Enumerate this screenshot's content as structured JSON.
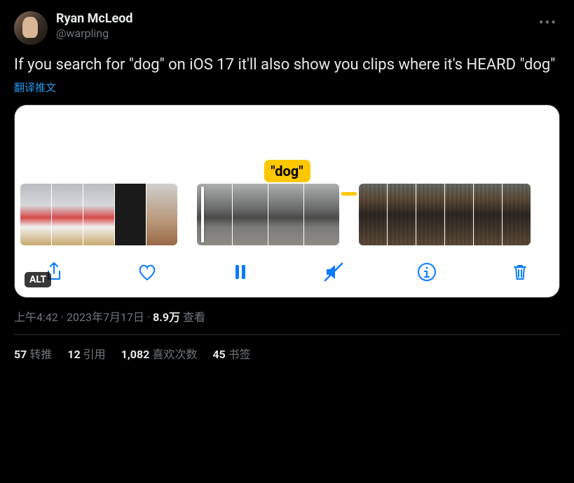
{
  "author": {
    "display_name": "Ryan McLeod",
    "handle": "@warpling"
  },
  "body": "If you search for \"dog\" on iOS 17 it'll also show you clips where it's HEARD \"dog\"",
  "translate_label": "翻译推文",
  "media": {
    "badge_text": "\"dog\"",
    "alt_label": "ALT"
  },
  "meta": {
    "time": "上午4:42",
    "sep1": " · ",
    "date": "2023年7月17日",
    "sep2": " · ",
    "views_count": "8.9万",
    "views_label": " 查看"
  },
  "stats": {
    "retweets_count": "57",
    "retweets_label": " 转推",
    "quotes_count": "12",
    "quotes_label": " 引用",
    "likes_count": "1,082",
    "likes_label": " 喜欢次数",
    "bookmarks_count": "45",
    "bookmarks_label": " 书签"
  }
}
